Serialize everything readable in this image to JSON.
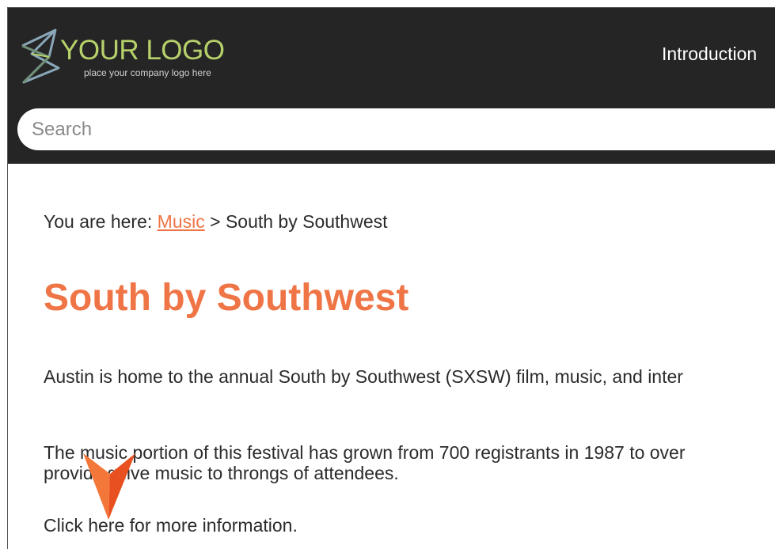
{
  "header": {
    "logo": {
      "title": "YOUR LOGO",
      "subtitle": "place your company logo here",
      "icon": "geometric-triangle-logo-icon",
      "title_color": "#b6d16a"
    },
    "nav": [
      {
        "label": "Introduction"
      }
    ],
    "search": {
      "placeholder": "Search",
      "value": ""
    },
    "background_color": "#252525"
  },
  "breadcrumb": {
    "prefix": "You are here:",
    "link": "Music",
    "separator": ">",
    "current": "South by Southwest"
  },
  "main": {
    "title": "South by Southwest",
    "title_color": "#ef7546",
    "paragraphs": [
      "Austin is home to the annual South by Southwest (SXSW) film, music, and inter",
      "The music portion of this festival has grown from 700 registrants in 1987 to over",
      "providing live music to throngs of attendees."
    ],
    "more_link": "Click here for more information."
  },
  "pointer": {
    "icon": "orange-arrow-pointer-icon",
    "color": "#ee5a24"
  }
}
